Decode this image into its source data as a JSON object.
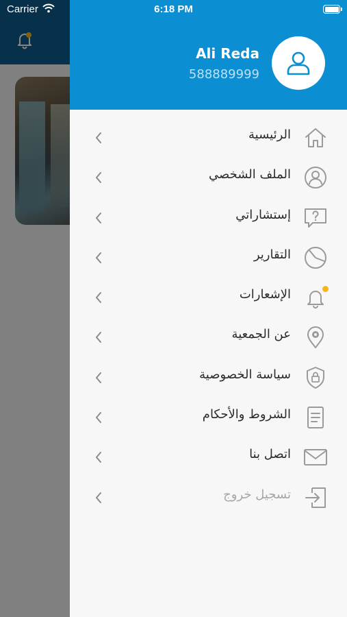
{
  "status_bar": {
    "carrier": "Carrier",
    "time": "6:18 PM"
  },
  "user": {
    "name": "Ali Reda",
    "phone": "588889999"
  },
  "menu": [
    {
      "label": "الرئيسية",
      "icon": "home-icon"
    },
    {
      "label": "الملف الشخصي",
      "icon": "profile-icon"
    },
    {
      "label": "إستشاراتي",
      "icon": "question-chat-icon"
    },
    {
      "label": "التقارير",
      "icon": "pie-chart-icon"
    },
    {
      "label": "الإشعارات",
      "icon": "bell-icon"
    },
    {
      "label": "عن الجمعية",
      "icon": "location-pin-icon"
    },
    {
      "label": "سياسة الخصوصية",
      "icon": "shield-lock-icon"
    },
    {
      "label": "الشروط والأحكام",
      "icon": "document-icon"
    },
    {
      "label": "اتصل بنا",
      "icon": "envelope-icon"
    },
    {
      "label": "تسجيل خروج",
      "icon": "logout-icon"
    }
  ],
  "colors": {
    "header_blue": "#0b8fd2",
    "notification_dot": "#f5b51b",
    "icon_gray": "#9a9a9a"
  }
}
